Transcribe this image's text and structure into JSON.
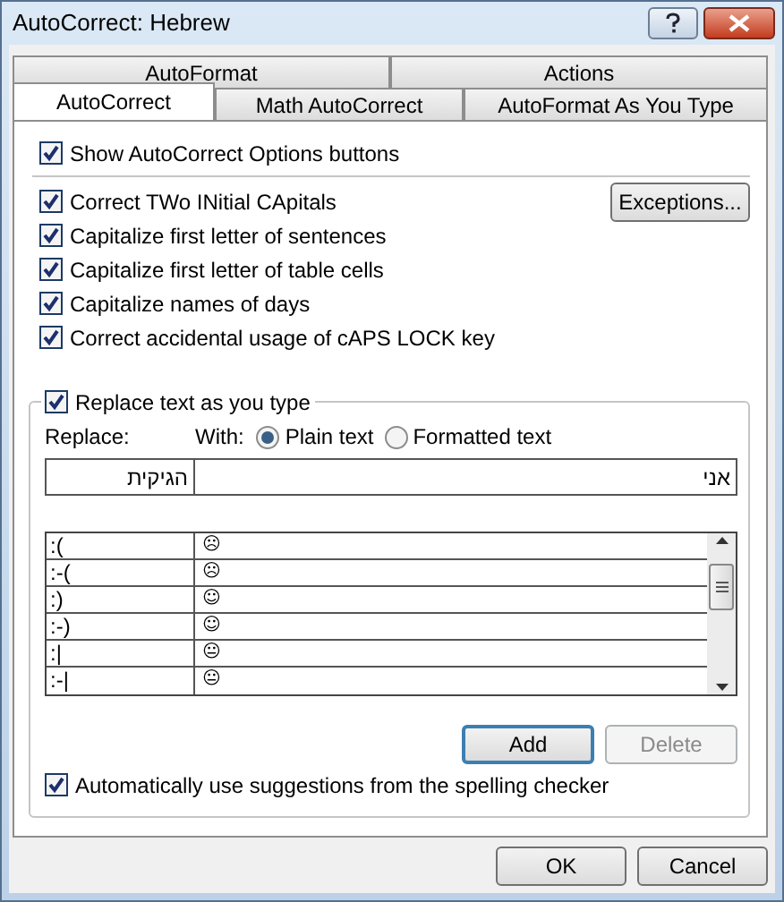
{
  "window": {
    "title": "AutoCorrect: Hebrew"
  },
  "tab_rows": [
    [
      {
        "label": "AutoFormat",
        "selected": false
      },
      {
        "label": "Actions",
        "selected": false
      }
    ],
    [
      {
        "label": "AutoCorrect",
        "selected": true
      },
      {
        "label": "Math AutoCorrect",
        "selected": false
      },
      {
        "label": "AutoFormat As You Type",
        "selected": false
      }
    ]
  ],
  "show_options": {
    "label": "Show AutoCorrect Options buttons",
    "checked": true
  },
  "options": [
    {
      "label": "Correct TWo INitial CApitals",
      "checked": true
    },
    {
      "label": "Capitalize first letter of sentences",
      "checked": true
    },
    {
      "label": "Capitalize first letter of table cells",
      "checked": true
    },
    {
      "label": "Capitalize names of days",
      "checked": true
    },
    {
      "label": "Correct accidental usage of cAPS LOCK key",
      "checked": true
    }
  ],
  "exceptions_button": "Exceptions...",
  "replace_group": {
    "label": "Replace text as you type",
    "checked": true,
    "replace_label": "Replace:",
    "with_label": "With:",
    "radios": [
      {
        "label": "Plain text",
        "selected": true
      },
      {
        "label": "Formatted text",
        "selected": false
      }
    ],
    "replace_value": "הגיקית",
    "with_value": "אני",
    "entries": [
      {
        "replace": ":(",
        "with": "☹"
      },
      {
        "replace": ":-(",
        "with": "☹"
      },
      {
        "replace": ":)",
        "with": "☺"
      },
      {
        "replace": ":-)",
        "with": "☺"
      },
      {
        "replace": ":|",
        "with": "😐"
      },
      {
        "replace": ":-|",
        "with": "😐"
      }
    ],
    "buttons": [
      {
        "label": "Add",
        "disabled": false
      },
      {
        "label": "Delete",
        "disabled": true
      }
    ],
    "spelling": {
      "label": "Automatically use suggestions from the spelling checker",
      "checked": true
    }
  },
  "dialog_buttons": [
    "OK",
    "Cancel"
  ]
}
